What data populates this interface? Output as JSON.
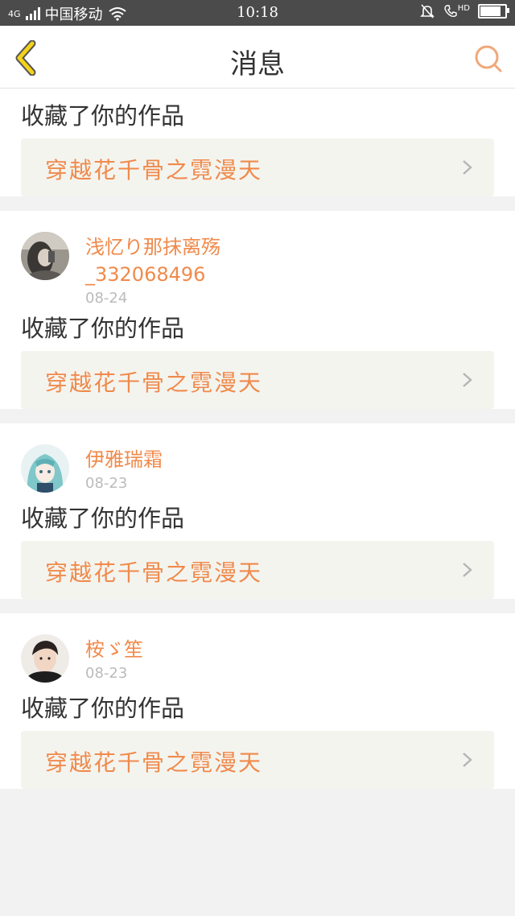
{
  "status_bar": {
    "carrier": "中国移动",
    "network": "4G",
    "time": "10:18",
    "hd": "HD",
    "battery_level": 0.9
  },
  "nav": {
    "title": "消息"
  },
  "colors": {
    "accent": "#f08a4b",
    "back_arrow": "#f5d21a",
    "work_box_bg": "#f4f4ef"
  },
  "messages": [
    {
      "action": "收藏了你的作品",
      "work_title": "穿越花千骨之霓漫天"
    },
    {
      "user_name_1": "浅忆り那抹离殇",
      "user_name_2": "_332068496",
      "date": "08-24",
      "avatar": "girl-photo-avatar",
      "action": "收藏了你的作品",
      "work_title": "穿越花千骨之霓漫天"
    },
    {
      "user_name_1": "伊雅瑞霜",
      "date": "08-23",
      "avatar": "anime-girl-avatar",
      "action": "收藏了你的作品",
      "work_title": "穿越花千骨之霓漫天"
    },
    {
      "user_name_1": "桉ゞ笙",
      "date": "08-23",
      "avatar": "boy-photo-avatar",
      "action": "收藏了你的作品",
      "work_title": "穿越花千骨之霓漫天"
    }
  ]
}
